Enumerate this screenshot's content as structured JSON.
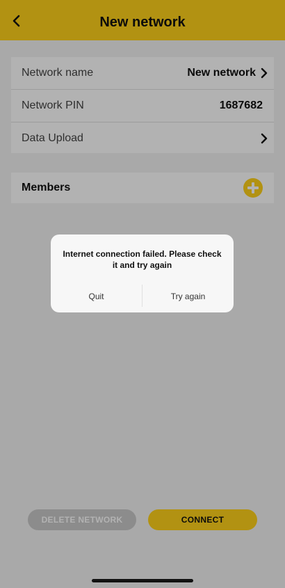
{
  "header": {
    "title": "New network",
    "back_icon": "chevron-left-icon"
  },
  "settings": {
    "network_name_label": "Network name",
    "network_name_value": "New network",
    "network_pin_label": "Network PIN",
    "network_pin_value": "1687682",
    "data_upload_label": "Data Upload",
    "chevron_icon": "chevron-right-icon"
  },
  "members": {
    "title": "Members",
    "add_icon": "plus-circle-icon"
  },
  "actions": {
    "delete_label": "DELETE NETWORK",
    "connect_label": "CONNECT"
  },
  "dialog": {
    "message": "Internet connection failed. Please check it and try again",
    "quit_label": "Quit",
    "retry_label": "Try again"
  },
  "colors": {
    "accent": "#ffd21a",
    "background": "#f2f2f2",
    "disabled_button": "#c9c9c9"
  }
}
